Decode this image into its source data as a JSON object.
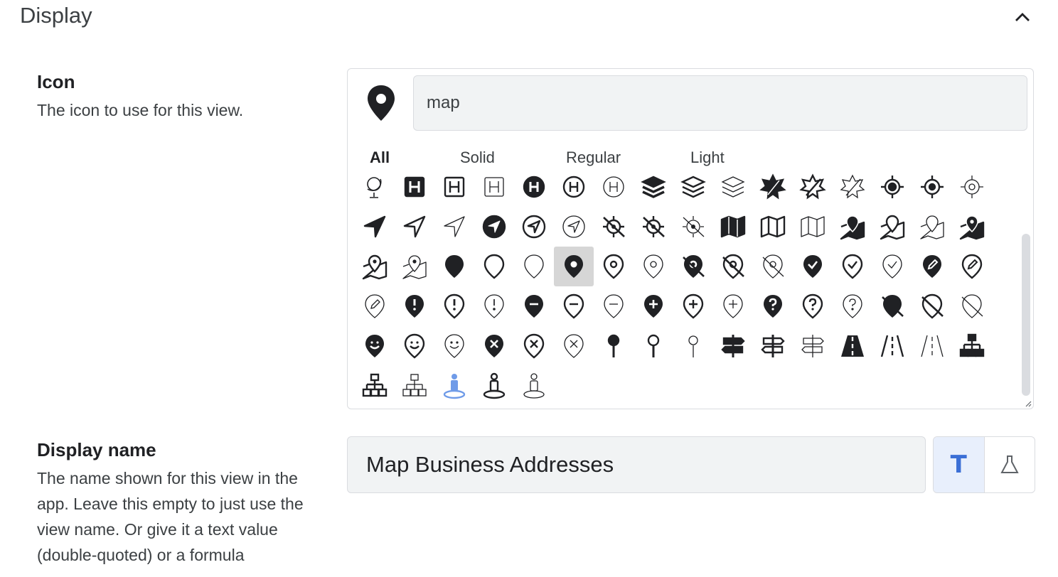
{
  "section": {
    "title": "Display"
  },
  "icon_field": {
    "label": "Icon",
    "description": "The icon to use for this view.",
    "search_value": "map",
    "tabs": [
      {
        "label": "All",
        "active": true
      },
      {
        "label": "Solid",
        "active": false
      },
      {
        "label": "Regular",
        "active": false
      },
      {
        "label": "Light",
        "active": false
      }
    ],
    "icons": [
      "globe-stand-icon",
      "hospital-sign-solid-icon",
      "hospital-sign-regular-icon",
      "hospital-sign-light-icon",
      "hospital-circle-solid-icon",
      "hospital-circle-regular-icon",
      "hospital-circle-light-icon",
      "layer-group-solid-icon",
      "layer-group-regular-icon",
      "layer-group-light-icon",
      "map-leaf-solid-icon",
      "map-leaf-regular-icon",
      "map-leaf-light-icon",
      "location-crosshair-solid-icon",
      "location-crosshair-regular-icon",
      "location-crosshair-light-icon",
      "location-arrow-solid-icon",
      "location-arrow-regular-icon",
      "location-arrow-light-icon",
      "location-circle-solid-icon",
      "location-circle-regular-icon",
      "location-circle-light-icon",
      "location-slash-solid-icon",
      "location-slash-regular-icon",
      "location-slash-light-icon",
      "map-solid-icon",
      "map-regular-icon",
      "map-light-icon",
      "map-marked-solid-icon",
      "map-marked-regular-icon",
      "map-marked-light-icon",
      "map-marked-alt-solid-icon",
      "map-marked-alt-regular-icon",
      "map-marked-alt-light-icon",
      "map-marker-solid-icon",
      "map-marker-regular-icon",
      "map-marker-light-icon",
      "map-marker-alt-solid-icon",
      "map-marker-alt-regular-icon",
      "map-marker-alt-light-icon",
      "map-marker-alt-slash-solid-icon",
      "map-marker-alt-slash-regular-icon",
      "map-marker-alt-slash-light-icon",
      "map-marker-check-solid-icon",
      "map-marker-check-regular-icon",
      "map-marker-check-light-icon",
      "map-marker-edit-solid-icon",
      "map-marker-edit-regular-icon",
      "map-marker-edit-light-icon",
      "map-marker-exclamation-solid-icon",
      "map-marker-exclamation-regular-icon",
      "map-marker-exclamation-light-icon",
      "map-marker-minus-solid-icon",
      "map-marker-minus-regular-icon",
      "map-marker-minus-light-icon",
      "map-marker-plus-solid-icon",
      "map-marker-plus-regular-icon",
      "map-marker-plus-light-icon",
      "map-marker-question-solid-icon",
      "map-marker-question-regular-icon",
      "map-marker-question-light-icon",
      "map-marker-slash-solid-icon",
      "map-marker-slash-regular-icon",
      "map-marker-slash-light-icon",
      "map-marker-smile-solid-icon",
      "map-marker-smile-regular-icon",
      "map-marker-smile-light-icon",
      "map-marker-times-solid-icon",
      "map-marker-times-regular-icon",
      "map-marker-times-light-icon",
      "map-pin-solid-icon",
      "map-pin-regular-icon",
      "map-pin-light-icon",
      "map-signs-solid-icon",
      "map-signs-regular-icon",
      "map-signs-light-icon",
      "road-solid-icon",
      "road-regular-icon",
      "road-light-icon",
      "sitemap-solid-icon",
      "sitemap-regular-icon",
      "sitemap-light-icon",
      "street-view-duotone-icon",
      "street-view-regular-icon",
      "street-view-light-icon"
    ],
    "selected_index": 37
  },
  "display_name_field": {
    "label": "Display name",
    "description": "The name shown for this view in the app. Leave this empty to just use the view name. Or give it a text value (double-quoted) or a formula",
    "value": "Map Business Addresses",
    "mode_text_label": "T"
  },
  "colors": {
    "accent": "#3b6fd6",
    "selected_bg": "#d6d6d6",
    "input_bg": "#f1f3f4",
    "icon": "#202124",
    "duotone_blue": "#6f9be8"
  }
}
